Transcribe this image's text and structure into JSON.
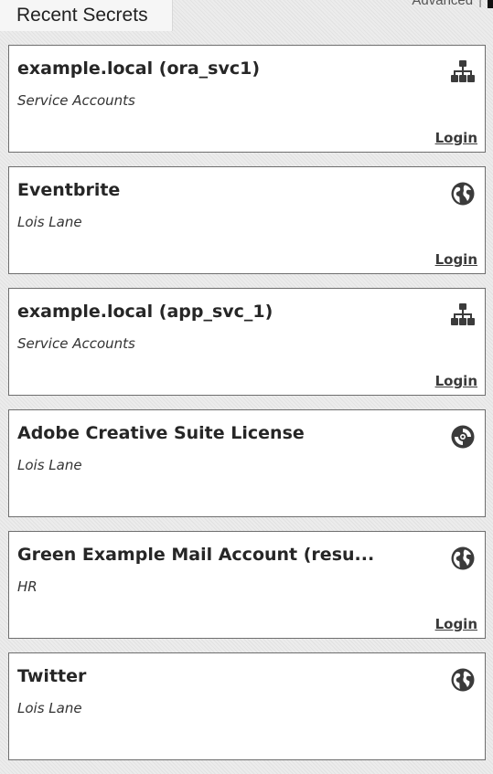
{
  "header": {
    "title": "Recent Secrets"
  },
  "top_right": {
    "advanced_label": "Advanced",
    "separator": "|"
  },
  "login_label": "Login",
  "secrets": [
    {
      "title": "example.local (ora_svc1)",
      "subtitle": "Service Accounts",
      "icon": "network-icon",
      "has_login": true
    },
    {
      "title": "Eventbrite",
      "subtitle": "Lois Lane",
      "icon": "globe-icon",
      "has_login": true
    },
    {
      "title": "example.local (app_svc_1)",
      "subtitle": "Service Accounts",
      "icon": "network-icon",
      "has_login": true
    },
    {
      "title": "Adobe Creative Suite License",
      "subtitle": "Lois Lane",
      "icon": "disc-icon",
      "has_login": false
    },
    {
      "title": "Green Example Mail Account (resu...",
      "subtitle": "HR",
      "icon": "globe-icon",
      "has_login": true
    },
    {
      "title": "Twitter",
      "subtitle": "Lois Lane",
      "icon": "globe-icon",
      "has_login": false
    }
  ]
}
